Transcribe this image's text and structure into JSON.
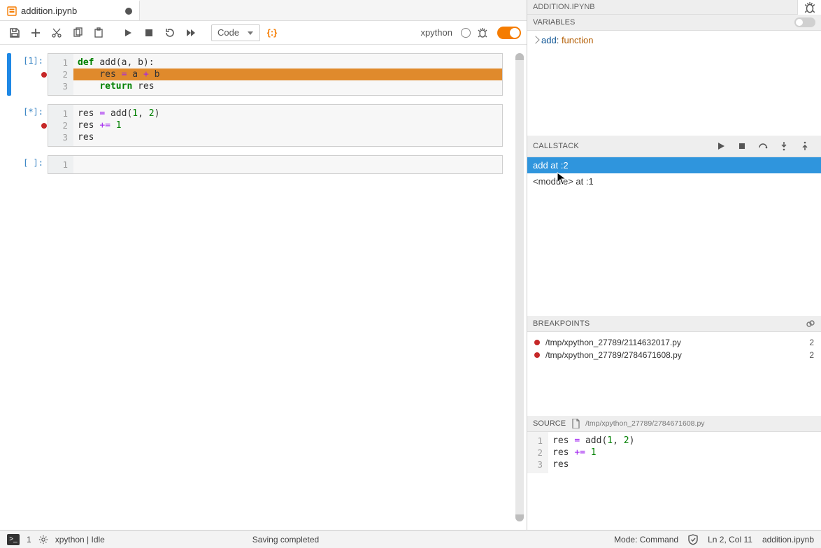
{
  "tab": {
    "title": "addition.ipynb",
    "dirty": true
  },
  "toolbar": {
    "celltype": "Code",
    "kernel": "xpython"
  },
  "cells": [
    {
      "prompt": "[1]:",
      "active": true,
      "lines": [
        {
          "n": 1,
          "bp": false,
          "hl": false,
          "seg": [
            {
              "t": "def ",
              "c": "k-def"
            },
            {
              "t": "add(a, b):"
            }
          ]
        },
        {
          "n": 2,
          "bp": true,
          "hl": true,
          "seg": [
            {
              "t": "    res "
            },
            {
              "t": "=",
              "c": "k-op"
            },
            {
              "t": " a "
            },
            {
              "t": "+",
              "c": "k-op"
            },
            {
              "t": " b"
            }
          ]
        },
        {
          "n": 3,
          "bp": false,
          "hl": false,
          "seg": [
            {
              "t": "    "
            },
            {
              "t": "return",
              "c": "k-ret"
            },
            {
              "t": " res"
            }
          ]
        }
      ]
    },
    {
      "prompt": "[*]:",
      "active": false,
      "lines": [
        {
          "n": 1,
          "bp": false,
          "hl": false,
          "seg": [
            {
              "t": "res "
            },
            {
              "t": "=",
              "c": "k-op"
            },
            {
              "t": " add("
            },
            {
              "t": "1",
              "c": "k-num"
            },
            {
              "t": ", "
            },
            {
              "t": "2",
              "c": "k-num"
            },
            {
              "t": ")"
            }
          ]
        },
        {
          "n": 2,
          "bp": true,
          "hl": false,
          "seg": [
            {
              "t": "res "
            },
            {
              "t": "+=",
              "c": "k-op"
            },
            {
              "t": " "
            },
            {
              "t": "1",
              "c": "k-num"
            }
          ]
        },
        {
          "n": 3,
          "bp": false,
          "hl": false,
          "seg": [
            {
              "t": "res"
            }
          ]
        }
      ]
    },
    {
      "prompt": "[ ]:",
      "active": false,
      "lines": [
        {
          "n": 1,
          "bp": false,
          "hl": false,
          "seg": [
            {
              "t": ""
            }
          ]
        }
      ]
    }
  ],
  "debug": {
    "file_upper": "ADDITION.IPYNB",
    "variables_label": "VARIABLES",
    "variables": [
      {
        "name": "add",
        "type": "function"
      }
    ],
    "callstack_label": "CALLSTACK",
    "callstack": [
      {
        "text": "add at :2",
        "active": true
      },
      {
        "text": "<module> at :1",
        "active": false
      }
    ],
    "breakpoints_label": "BREAKPOINTS",
    "breakpoints": [
      {
        "path": "/tmp/xpython_27789/2114632017.py",
        "line": 2
      },
      {
        "path": "/tmp/xpython_27789/2784671608.py",
        "line": 2
      }
    ],
    "source_label": "SOURCE",
    "source_path": "/tmp/xpython_27789/2784671608.py",
    "source_lines": [
      {
        "n": 1,
        "bp": false,
        "seg": [
          {
            "t": "res "
          },
          {
            "t": "=",
            "c": "k-op"
          },
          {
            "t": " add("
          },
          {
            "t": "1",
            "c": "k-num"
          },
          {
            "t": ", "
          },
          {
            "t": "2",
            "c": "k-num"
          },
          {
            "t": ")"
          }
        ]
      },
      {
        "n": 2,
        "bp": true,
        "seg": [
          {
            "t": "res "
          },
          {
            "t": "+=",
            "c": "k-op"
          },
          {
            "t": " "
          },
          {
            "t": "1",
            "c": "k-num"
          }
        ]
      },
      {
        "n": 3,
        "bp": false,
        "seg": [
          {
            "t": "res"
          }
        ]
      }
    ]
  },
  "status": {
    "terminals": "1",
    "kernel_msg": "xpython | Idle",
    "save_msg": "Saving completed",
    "mode": "Mode: Command",
    "pos": "Ln 2, Col 11",
    "file": "addition.ipynb"
  }
}
